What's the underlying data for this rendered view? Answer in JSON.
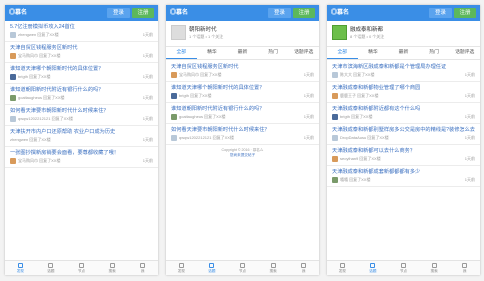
{
  "header": {
    "logo": "◎慕名",
    "login": "登录",
    "register": "注册"
  },
  "nav": [
    "发现",
    "话题",
    "节点",
    "搜索",
    "我"
  ],
  "panel1": {
    "items": [
      {
        "title": "5.7亿注册模拟币攻入24首位",
        "user": "zhengwen",
        "time": "回复了XX楼",
        "right": "1天前"
      },
      {
        "title": "天津自贸区钱程服务区新时代",
        "user": "宝马购风巾",
        "time": "回复了XX楼",
        "right": "1天前"
      },
      {
        "title": "谁知道天津哪个朝阳新时代的具体位置？",
        "user": "brigth",
        "time": "回复了XX楼",
        "right": "1天前"
      },
      {
        "title": "谁知道朝阳新时代附近有银行什么的吗？",
        "user": "goaltaugheus",
        "time": "回复了XX楼",
        "right": "1天前"
      },
      {
        "title": "如何看天津要市朝阳新时代什么时候来住？",
        "user": "qwqw1202212121",
        "time": "回复了XX楼",
        "right": "1天前"
      },
      {
        "title": "天津扶开市内户口还原帮助 农业户口成为历史",
        "user": "zhengwen",
        "time": "回复了XX楼",
        "right": "1天前"
      },
      {
        "title": "一张图抄撰新房销要会面看，要尊都收藏了哦！",
        "user": "宝马购风巾",
        "time": "回复了XX楼",
        "right": "1天前"
      }
    ]
  },
  "panel2": {
    "node": "朝阳新时代",
    "sub": "1 个话题 • 1 个关注",
    "tabs": [
      "全部",
      "精华",
      "最新",
      "热门",
      "话题评选"
    ],
    "items": [
      {
        "title": "天津自贸区钱程服务区新时代",
        "user": "宝马购风巾",
        "time": "回复了XX楼",
        "right": "1天前"
      },
      {
        "title": "谁知道天津哪个朝阳新时代的具体位置？",
        "user": "brigth",
        "time": "回复了XX楼",
        "right": "1天前"
      },
      {
        "title": "谁知道朝阳新时代附近有银行什么的吗？",
        "user": "goaltaugheus",
        "time": "回复了XX楼",
        "right": "1天前"
      },
      {
        "title": "如何看天津要市朝阳新时代什么时候来住？",
        "user": "qwqw1202212121",
        "time": "回复了XX楼",
        "right": "1天前"
      }
    ],
    "footer1": "Copyright © 2016 · 慕名ㄙ",
    "footer2": "您尚未提交帖子"
  },
  "panel3": {
    "node": "融成泰和新都",
    "sub": "8 个话题 • 0 个关注",
    "tabs": [
      "全部",
      "精华",
      "最新",
      "热门",
      "话题评选"
    ],
    "items": [
      {
        "title": "天津市滨海新区融成泰和新都是个管理局办理任证",
        "user": "陈大大",
        "time": "回复了XX楼",
        "right": "1天前"
      },
      {
        "title": "天津融成泰和新都物业管理了哪个商园",
        "user": "鹿鹿王子",
        "time": "回复了XX楼",
        "right": "1天前"
      },
      {
        "title": "天津融成泰和新都附近都有这个什么吗",
        "user": "brigth",
        "time": "回复了XX楼",
        "right": "1天前"
      },
      {
        "title": "天津融成泰和新都别墅样房多公交是房中的精线是?装修怎么去装修?",
        "user": "DropDataAusu",
        "time": "回复了XX楼",
        "right": "1天前"
      },
      {
        "title": "天津融成泰和新都可以去什么商务？",
        "user": "seoyihan9",
        "time": "回复了XX楼",
        "right": "1天前"
      },
      {
        "title": "天津融成泰和新都成套新都都都有多少",
        "user": "嘻嘻",
        "time": "回复了XX楼",
        "right": "1天前"
      }
    ]
  }
}
